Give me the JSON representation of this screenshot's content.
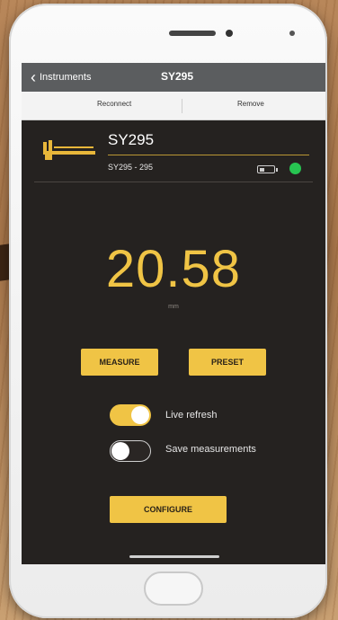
{
  "navbar": {
    "back_label": "Instruments",
    "title": "SY295"
  },
  "tabs": {
    "left": "Reconnect",
    "right": "Remove"
  },
  "device": {
    "name": "SY295",
    "subtitle": "SY295 - 295",
    "connection_status": "connected",
    "status_color": "#27c451"
  },
  "measurement": {
    "value": "20.58",
    "unit": "mm"
  },
  "buttons": {
    "measure": "MEASURE",
    "preset": "PRESET",
    "configure": "CONFIGURE"
  },
  "toggles": {
    "live_refresh": {
      "label": "Live refresh",
      "on": true
    },
    "save_measurements": {
      "label": "Save measurements",
      "on": false
    }
  },
  "colors": {
    "accent": "#f0c445",
    "screen_bg": "#252220",
    "navbar_bg": "#5b5d5f"
  },
  "icons": [
    "back-chevron-icon",
    "brand-logo-icon",
    "battery-icon",
    "status-dot-icon"
  ]
}
